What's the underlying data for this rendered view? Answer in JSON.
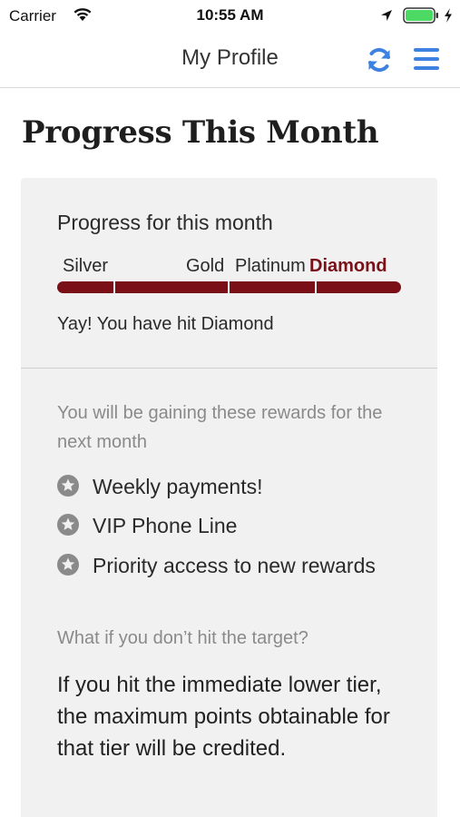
{
  "status_bar": {
    "carrier": "Carrier",
    "time": "10:55 AM",
    "icons": [
      "wifi-icon",
      "location-arrow-icon",
      "battery-icon",
      "charging-bolt-icon"
    ],
    "battery_color": "#4cd964"
  },
  "nav": {
    "title": "My Profile",
    "refresh_icon": "refresh-icon",
    "menu_icon": "hamburger-menu-icon",
    "accent_color": "#3d82e0"
  },
  "page": {
    "title": "Progress This Month"
  },
  "progress": {
    "label": "Progress for this month",
    "tiers": [
      "Silver",
      "Gold",
      "Platinum",
      "Diamond"
    ],
    "current_tier": "Diamond",
    "progress_fraction": 1.0,
    "bar_color": "#7a0f18",
    "status_text": "Yay! You have hit Diamond"
  },
  "rewards": {
    "intro": "You will be gaining these rewards for the next month",
    "icon": "star-badge-icon",
    "items": [
      "Weekly payments!",
      "VIP Phone Line",
      "Priority access to new rewards"
    ]
  },
  "fallback": {
    "question": "What if you don’t hit the target?",
    "answer": "If you hit the immediate lower tier, the maximum points obtainable for that tier will be credited."
  }
}
